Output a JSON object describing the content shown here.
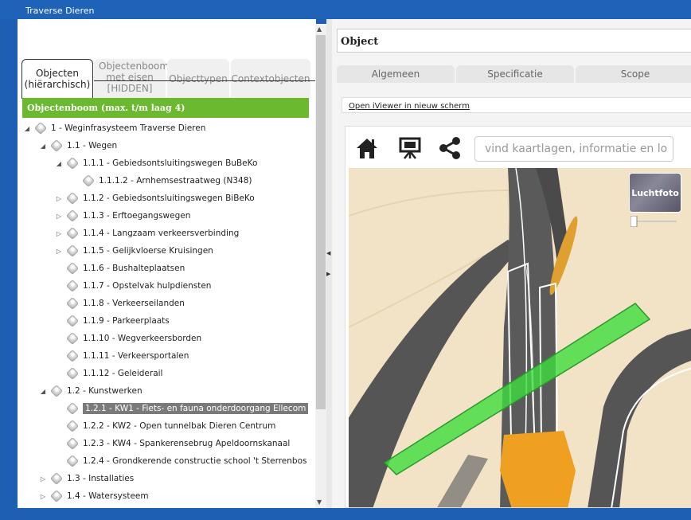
{
  "window": {
    "title": "Traverse Dieren"
  },
  "left_tabs": [
    {
      "label": "Objecten\n(hiërarchisch)",
      "active": true
    },
    {
      "label": "Objectenboom met eisen [HIDDEN]",
      "active": false
    },
    {
      "label": "Objecttypen",
      "active": false
    },
    {
      "label": "Contextobjecten",
      "active": false
    }
  ],
  "tree": {
    "header": "Objectenboom (max. t/m laag 4)",
    "items": [
      {
        "label": "1 - Weginfrasysteem Traverse Dieren",
        "depth": 0,
        "toggle": "expanded"
      },
      {
        "label": "1.1 - Wegen",
        "depth": 1,
        "toggle": "expanded"
      },
      {
        "label": "1.1.1 - Gebiedsontsluitingswegen BuBeKo",
        "depth": 2,
        "toggle": "expanded"
      },
      {
        "label": "1.1.1.2 - Arnhemsestraatweg (N348)",
        "depth": 3,
        "toggle": "none"
      },
      {
        "label": "1.1.2 - Gebiedsontsluitingswegen BiBeKo",
        "depth": 2,
        "toggle": "collapsed"
      },
      {
        "label": "1.1.3 - Erftoegangswegen",
        "depth": 2,
        "toggle": "collapsed"
      },
      {
        "label": "1.1.4 - Langzaam verkeersverbinding",
        "depth": 2,
        "toggle": "collapsed"
      },
      {
        "label": "1.1.5 - Gelijkvloerse Kruisingen",
        "depth": 2,
        "toggle": "collapsed"
      },
      {
        "label": "1.1.6 - Bushalteplaatsen",
        "depth": 2,
        "toggle": "none"
      },
      {
        "label": "1.1.7 - Opstelvak hulpdiensten",
        "depth": 2,
        "toggle": "none"
      },
      {
        "label": "1.1.8 - Verkeerseilanden",
        "depth": 2,
        "toggle": "none"
      },
      {
        "label": "1.1.9 - Parkeerplaats",
        "depth": 2,
        "toggle": "none"
      },
      {
        "label": "1.1.10 - Wegverkeersborden",
        "depth": 2,
        "toggle": "none"
      },
      {
        "label": "1.1.11 - Verkeersportalen",
        "depth": 2,
        "toggle": "none"
      },
      {
        "label": "1.1.12 - Geleiderail",
        "depth": 2,
        "toggle": "none"
      },
      {
        "label": "1.2 - Kunstwerken",
        "depth": 1,
        "toggle": "expanded"
      },
      {
        "label": "1.2.1 - KW1 - Fiets- en fauna onderdoorgang Ellecom",
        "depth": 2,
        "toggle": "none",
        "selected": true
      },
      {
        "label": "1.2.2 - KW2 - Open tunnelbak Dieren Centrum",
        "depth": 2,
        "toggle": "none"
      },
      {
        "label": "1.2.3 - KW4 - Spankerensebrug Apeldoornskanaal",
        "depth": 2,
        "toggle": "none"
      },
      {
        "label": "1.2.4 - Grondkerende constructie school 't Sterrenbos",
        "depth": 2,
        "toggle": "none"
      },
      {
        "label": "1.3 - Installaties",
        "depth": 1,
        "toggle": "collapsed"
      },
      {
        "label": "1.4 - Watersysteem",
        "depth": 1,
        "toggle": "collapsed"
      }
    ]
  },
  "object_panel": {
    "title": "Object",
    "tabs": [
      "Algemeen",
      "Specificatie",
      "Scope"
    ],
    "link": "Open iViewer in nieuw scherm"
  },
  "viewer": {
    "icons": [
      "home-icon",
      "presentation-icon",
      "share-icon"
    ],
    "search_placeholder": "vind kaartlagen, informatie en lo",
    "basemap_label": "Luchtfoto"
  },
  "colors": {
    "title_blue": "#1f63b8",
    "tree_header_green": "#6bb92f",
    "selection_gray": "#7a7a7a",
    "map_bg": "#f3e3c6",
    "road_dark": "#555555",
    "structure_green": "#3ddc3d",
    "structure_orange": "#f0a020"
  }
}
